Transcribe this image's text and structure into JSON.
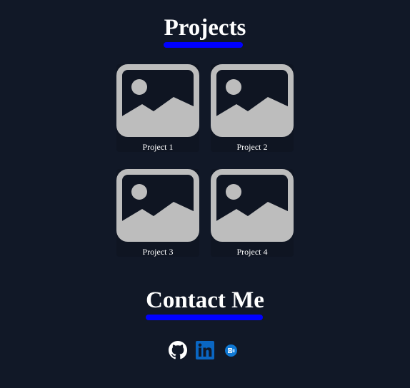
{
  "projects": {
    "heading": "Projects",
    "items": [
      {
        "label": "Project 1",
        "icon": "image-placeholder-icon"
      },
      {
        "label": "Project 2",
        "icon": "image-placeholder-icon"
      },
      {
        "label": "Project 3",
        "icon": "image-placeholder-icon"
      },
      {
        "label": "Project 4",
        "icon": "image-placeholder-icon"
      }
    ]
  },
  "contact": {
    "heading": "Contact Me",
    "links": [
      {
        "icon": "github-icon"
      },
      {
        "icon": "linkedin-icon"
      },
      {
        "icon": "outlook-icon"
      }
    ]
  },
  "colors": {
    "background": "#111827",
    "accent_underline": "#0000ff",
    "placeholder_gray": "#bdbdbd",
    "linkedin_blue": "#0a66c2",
    "outlook_blue": "#0f78d4"
  }
}
